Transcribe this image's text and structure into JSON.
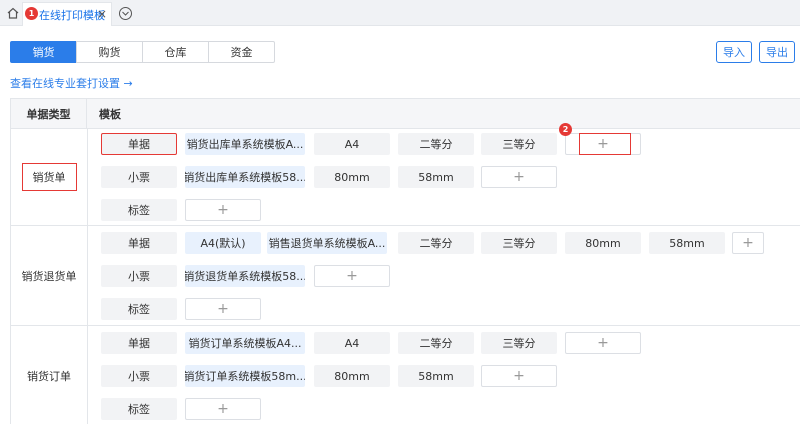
{
  "tabbar": {
    "home_icon": "home-icon",
    "active_tab_label": "在线打印模板",
    "close_glyph": "×",
    "more_icon": "chevron-down-circle-icon",
    "badge1": "1"
  },
  "module_tabs": [
    "销货",
    "购货",
    "仓库",
    "资金"
  ],
  "actions": {
    "import": "导入",
    "export": "导出"
  },
  "settings_link": "查看在线专业套打设置 →",
  "grid": {
    "col_type": "单据类型",
    "col_template": "模板"
  },
  "sections": [
    {
      "name": "销货单",
      "rows": [
        {
          "label": "单据",
          "cells": [
            "销货出库单系统模板A...",
            "A4",
            "二等分",
            "三等分"
          ]
        },
        {
          "label": "小票",
          "cells": [
            "销货出库单系统模板58...",
            "80mm",
            "58mm"
          ]
        },
        {
          "label": "标签",
          "cells": []
        }
      ]
    },
    {
      "name": "销货退货单",
      "rows": [
        {
          "label": "单据",
          "cells": [
            "A4(默认)",
            "销售退货单系统模板A...",
            "二等分",
            "三等分",
            "80mm",
            "58mm"
          ]
        },
        {
          "label": "小票",
          "cells": [
            "销货退货单系统模板58..."
          ]
        },
        {
          "label": "标签",
          "cells": []
        }
      ]
    },
    {
      "name": "销货订单",
      "rows": [
        {
          "label": "单据",
          "cells": [
            "销货订单系统模板A4...",
            "A4",
            "二等分",
            "三等分"
          ]
        },
        {
          "label": "小票",
          "cells": [
            "销货订单系统模板58m...",
            "80mm",
            "58mm"
          ]
        },
        {
          "label": "标签",
          "cells": []
        }
      ]
    }
  ],
  "add_glyph": "+",
  "badge2": "2",
  "colors": {
    "accent": "#2b7de9",
    "highlight": "#e53935",
    "cell_bg": "#f2f3f5",
    "cell_blue": "#e8f1fd"
  }
}
